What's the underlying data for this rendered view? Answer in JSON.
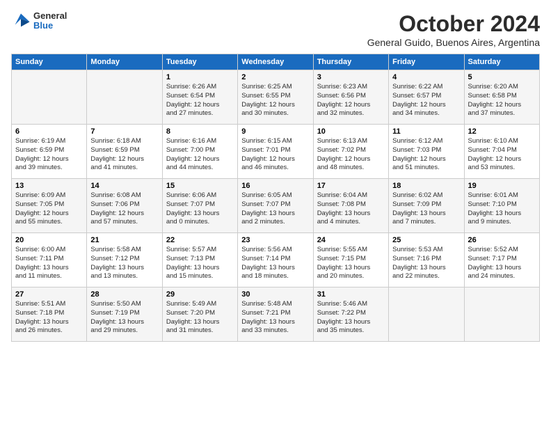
{
  "logo": {
    "general": "General",
    "blue": "Blue"
  },
  "header": {
    "month": "October 2024",
    "location": "General Guido, Buenos Aires, Argentina"
  },
  "weekdays": [
    "Sunday",
    "Monday",
    "Tuesday",
    "Wednesday",
    "Thursday",
    "Friday",
    "Saturday"
  ],
  "weeks": [
    [
      {
        "day": "",
        "content": ""
      },
      {
        "day": "",
        "content": ""
      },
      {
        "day": "1",
        "content": "Sunrise: 6:26 AM\nSunset: 6:54 PM\nDaylight: 12 hours\nand 27 minutes."
      },
      {
        "day": "2",
        "content": "Sunrise: 6:25 AM\nSunset: 6:55 PM\nDaylight: 12 hours\nand 30 minutes."
      },
      {
        "day": "3",
        "content": "Sunrise: 6:23 AM\nSunset: 6:56 PM\nDaylight: 12 hours\nand 32 minutes."
      },
      {
        "day": "4",
        "content": "Sunrise: 6:22 AM\nSunset: 6:57 PM\nDaylight: 12 hours\nand 34 minutes."
      },
      {
        "day": "5",
        "content": "Sunrise: 6:20 AM\nSunset: 6:58 PM\nDaylight: 12 hours\nand 37 minutes."
      }
    ],
    [
      {
        "day": "6",
        "content": "Sunrise: 6:19 AM\nSunset: 6:59 PM\nDaylight: 12 hours\nand 39 minutes."
      },
      {
        "day": "7",
        "content": "Sunrise: 6:18 AM\nSunset: 6:59 PM\nDaylight: 12 hours\nand 41 minutes."
      },
      {
        "day": "8",
        "content": "Sunrise: 6:16 AM\nSunset: 7:00 PM\nDaylight: 12 hours\nand 44 minutes."
      },
      {
        "day": "9",
        "content": "Sunrise: 6:15 AM\nSunset: 7:01 PM\nDaylight: 12 hours\nand 46 minutes."
      },
      {
        "day": "10",
        "content": "Sunrise: 6:13 AM\nSunset: 7:02 PM\nDaylight: 12 hours\nand 48 minutes."
      },
      {
        "day": "11",
        "content": "Sunrise: 6:12 AM\nSunset: 7:03 PM\nDaylight: 12 hours\nand 51 minutes."
      },
      {
        "day": "12",
        "content": "Sunrise: 6:10 AM\nSunset: 7:04 PM\nDaylight: 12 hours\nand 53 minutes."
      }
    ],
    [
      {
        "day": "13",
        "content": "Sunrise: 6:09 AM\nSunset: 7:05 PM\nDaylight: 12 hours\nand 55 minutes."
      },
      {
        "day": "14",
        "content": "Sunrise: 6:08 AM\nSunset: 7:06 PM\nDaylight: 12 hours\nand 57 minutes."
      },
      {
        "day": "15",
        "content": "Sunrise: 6:06 AM\nSunset: 7:07 PM\nDaylight: 13 hours\nand 0 minutes."
      },
      {
        "day": "16",
        "content": "Sunrise: 6:05 AM\nSunset: 7:07 PM\nDaylight: 13 hours\nand 2 minutes."
      },
      {
        "day": "17",
        "content": "Sunrise: 6:04 AM\nSunset: 7:08 PM\nDaylight: 13 hours\nand 4 minutes."
      },
      {
        "day": "18",
        "content": "Sunrise: 6:02 AM\nSunset: 7:09 PM\nDaylight: 13 hours\nand 7 minutes."
      },
      {
        "day": "19",
        "content": "Sunrise: 6:01 AM\nSunset: 7:10 PM\nDaylight: 13 hours\nand 9 minutes."
      }
    ],
    [
      {
        "day": "20",
        "content": "Sunrise: 6:00 AM\nSunset: 7:11 PM\nDaylight: 13 hours\nand 11 minutes."
      },
      {
        "day": "21",
        "content": "Sunrise: 5:58 AM\nSunset: 7:12 PM\nDaylight: 13 hours\nand 13 minutes."
      },
      {
        "day": "22",
        "content": "Sunrise: 5:57 AM\nSunset: 7:13 PM\nDaylight: 13 hours\nand 15 minutes."
      },
      {
        "day": "23",
        "content": "Sunrise: 5:56 AM\nSunset: 7:14 PM\nDaylight: 13 hours\nand 18 minutes."
      },
      {
        "day": "24",
        "content": "Sunrise: 5:55 AM\nSunset: 7:15 PM\nDaylight: 13 hours\nand 20 minutes."
      },
      {
        "day": "25",
        "content": "Sunrise: 5:53 AM\nSunset: 7:16 PM\nDaylight: 13 hours\nand 22 minutes."
      },
      {
        "day": "26",
        "content": "Sunrise: 5:52 AM\nSunset: 7:17 PM\nDaylight: 13 hours\nand 24 minutes."
      }
    ],
    [
      {
        "day": "27",
        "content": "Sunrise: 5:51 AM\nSunset: 7:18 PM\nDaylight: 13 hours\nand 26 minutes."
      },
      {
        "day": "28",
        "content": "Sunrise: 5:50 AM\nSunset: 7:19 PM\nDaylight: 13 hours\nand 29 minutes."
      },
      {
        "day": "29",
        "content": "Sunrise: 5:49 AM\nSunset: 7:20 PM\nDaylight: 13 hours\nand 31 minutes."
      },
      {
        "day": "30",
        "content": "Sunrise: 5:48 AM\nSunset: 7:21 PM\nDaylight: 13 hours\nand 33 minutes."
      },
      {
        "day": "31",
        "content": "Sunrise: 5:46 AM\nSunset: 7:22 PM\nDaylight: 13 hours\nand 35 minutes."
      },
      {
        "day": "",
        "content": ""
      },
      {
        "day": "",
        "content": ""
      }
    ]
  ]
}
